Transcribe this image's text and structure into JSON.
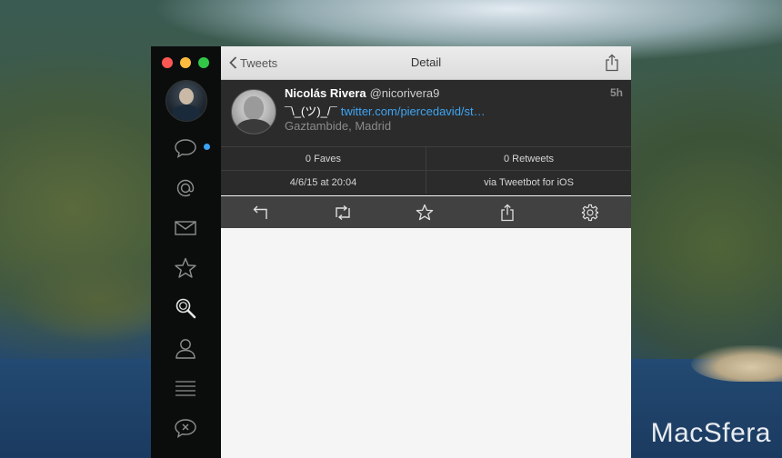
{
  "window": {
    "back_label": "Tweets",
    "title": "Detail"
  },
  "tweet": {
    "name": "Nicolás Rivera",
    "handle": "@nicorivera9",
    "time": "5h",
    "text": "¯\\_(ツ)_/¯",
    "link": "twitter.com/piercedavid/st…",
    "location": "Gaztambide, Madrid"
  },
  "stats": {
    "faves": "0 Faves",
    "retweets": "0 Retweets",
    "date": "4/6/15 at 20:04",
    "via": "via Tweetbot for iOS"
  },
  "sidebar": {
    "items": [
      {
        "icon": "speech-bubble-icon",
        "unread": true
      },
      {
        "icon": "at-mention-icon"
      },
      {
        "icon": "envelope-icon"
      },
      {
        "icon": "star-icon"
      },
      {
        "icon": "search-icon",
        "active": true
      },
      {
        "icon": "person-icon"
      },
      {
        "icon": "lists-icon"
      },
      {
        "icon": "muted-bubble-icon"
      }
    ]
  },
  "actions": [
    "reply-icon",
    "retweet-icon",
    "star-icon",
    "share-icon",
    "gear-icon"
  ],
  "watermark": "MacSfera",
  "colors": {
    "link": "#3ea5f4",
    "unread_dot": "#3ba3f5",
    "tweet_bg": "#2b2b2b",
    "action_bar_bg": "#414141",
    "sidebar_bg": "#0b0d0d"
  }
}
